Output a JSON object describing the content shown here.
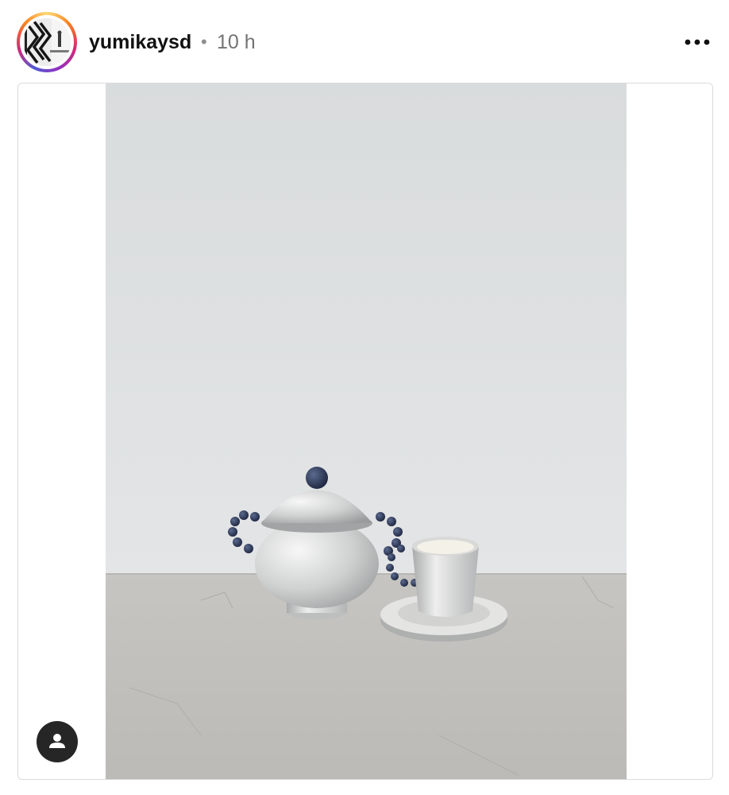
{
  "post": {
    "username": "yumikaysd",
    "separator": "•",
    "time_ago": "10 h"
  },
  "icons": {
    "more": "more-horizontal-icon",
    "tag": "user-tag-icon"
  },
  "colors": {
    "story_ring": "#d62976",
    "username_text": "#111111",
    "meta_text": "#737373",
    "tag_button_bg": "#262626"
  }
}
